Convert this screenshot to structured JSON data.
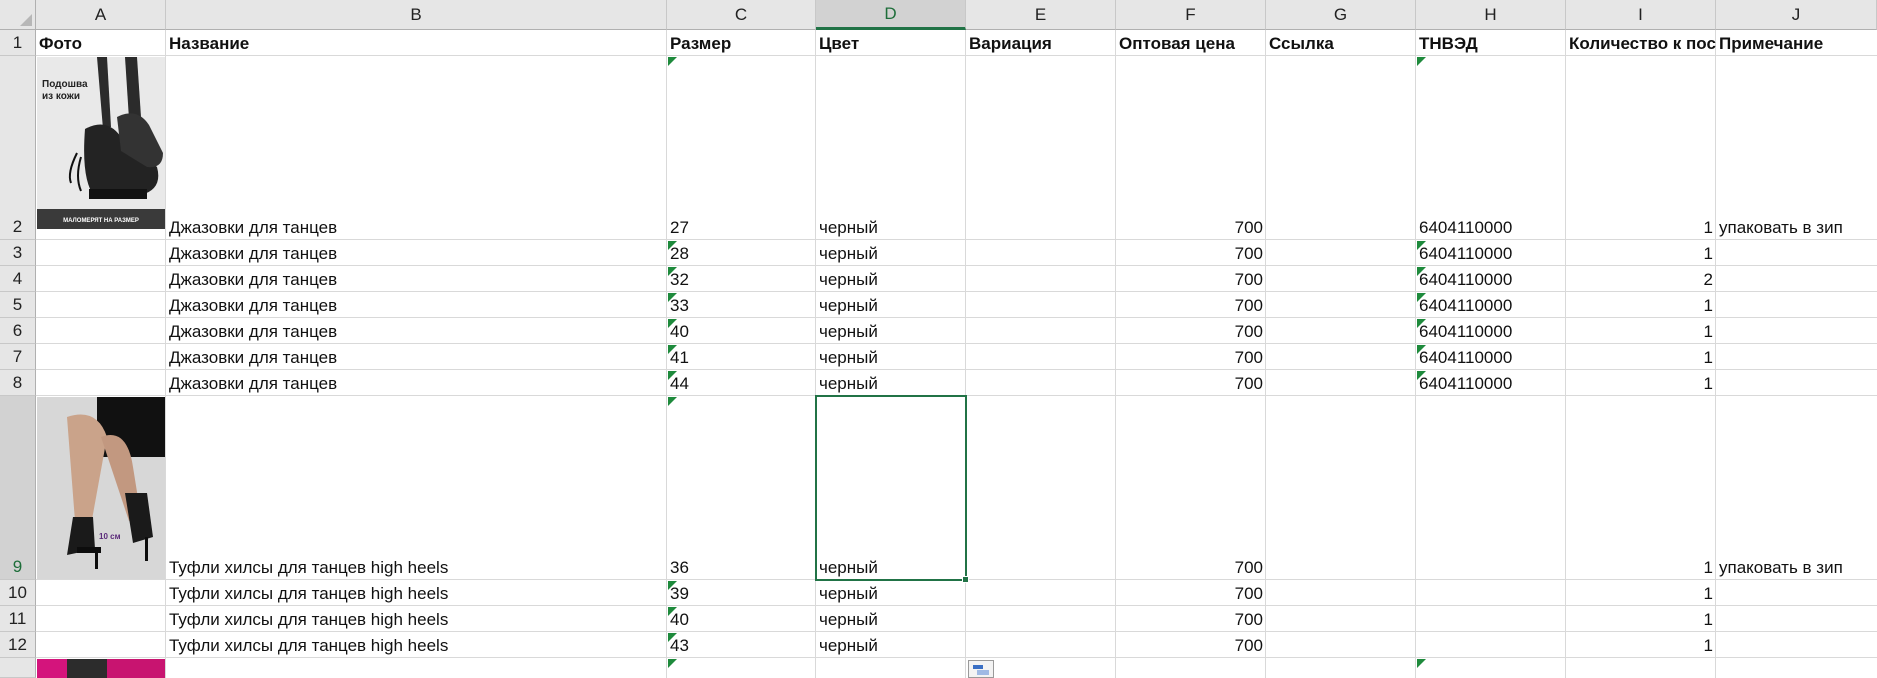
{
  "columns": [
    "A",
    "B",
    "C",
    "D",
    "E",
    "F",
    "G",
    "H",
    "I",
    "J"
  ],
  "selected_column": "D",
  "selected_row": "9",
  "row_numbers": [
    "1",
    "2",
    "3",
    "4",
    "5",
    "6",
    "7",
    "8",
    "9",
    "10",
    "11",
    "12"
  ],
  "headers": {
    "A": "Фото",
    "B": "Название",
    "C": "Размер",
    "D": "Цвет",
    "E": "Вариация",
    "F": "Оптовая цена",
    "G": "Ссылка",
    "H": "ТНВЭД",
    "I": "Количество к пос",
    "J": "Примечание"
  },
  "rows": [
    {
      "row": "2",
      "name": "Джазовки для танцев",
      "size": "27",
      "color": "черный",
      "price": "700",
      "tnved": "6404110000",
      "qty": "1",
      "note": "упаковать в зип"
    },
    {
      "row": "3",
      "name": "Джазовки для танцев",
      "size": "28",
      "color": "черный",
      "price": "700",
      "tnved": "6404110000",
      "qty": "1",
      "note": ""
    },
    {
      "row": "4",
      "name": "Джазовки для танцев",
      "size": "32",
      "color": "черный",
      "price": "700",
      "tnved": "6404110000",
      "qty": "2",
      "note": ""
    },
    {
      "row": "5",
      "name": "Джазовки для танцев",
      "size": "33",
      "color": "черный",
      "price": "700",
      "tnved": "6404110000",
      "qty": "1",
      "note": ""
    },
    {
      "row": "6",
      "name": "Джазовки для танцев",
      "size": "40",
      "color": "черный",
      "price": "700",
      "tnved": "6404110000",
      "qty": "1",
      "note": ""
    },
    {
      "row": "7",
      "name": "Джазовки для танцев",
      "size": "41",
      "color": "черный",
      "price": "700",
      "tnved": "6404110000",
      "qty": "1",
      "note": ""
    },
    {
      "row": "8",
      "name": "Джазовки для танцев",
      "size": "44",
      "color": "черный",
      "price": "700",
      "tnved": "6404110000",
      "qty": "1",
      "note": ""
    },
    {
      "row": "9",
      "name": "Туфли хилсы для танцев high heels",
      "size": "36",
      "color": "черный",
      "price": "700",
      "tnved": "",
      "qty": "1",
      "note": "упаковать в зип"
    },
    {
      "row": "10",
      "name": "Туфли хилсы для танцев high heels",
      "size": "39",
      "color": "черный",
      "price": "700",
      "tnved": "",
      "qty": "1",
      "note": ""
    },
    {
      "row": "11",
      "name": "Туфли хилсы для танцев high heels",
      "size": "40",
      "color": "черный",
      "price": "700",
      "tnved": "",
      "qty": "1",
      "note": ""
    },
    {
      "row": "12",
      "name": "Туфли хилсы для танцев high heels",
      "size": "43",
      "color": "черный",
      "price": "700",
      "tnved": "",
      "qty": "1",
      "note": ""
    }
  ],
  "photos": {
    "jazz": {
      "caption_top": "Подошва из кожи",
      "caption_bottom": "МАЛОМЕРЯТ НА РАЗМЕР"
    },
    "heels": {
      "caption": "10 см"
    }
  },
  "icons": {
    "paste_options": "paste-options-icon"
  },
  "colors": {
    "accent": "#217346",
    "header_bg": "#e6e6e6",
    "comment_marker": "#1e8a3c"
  }
}
